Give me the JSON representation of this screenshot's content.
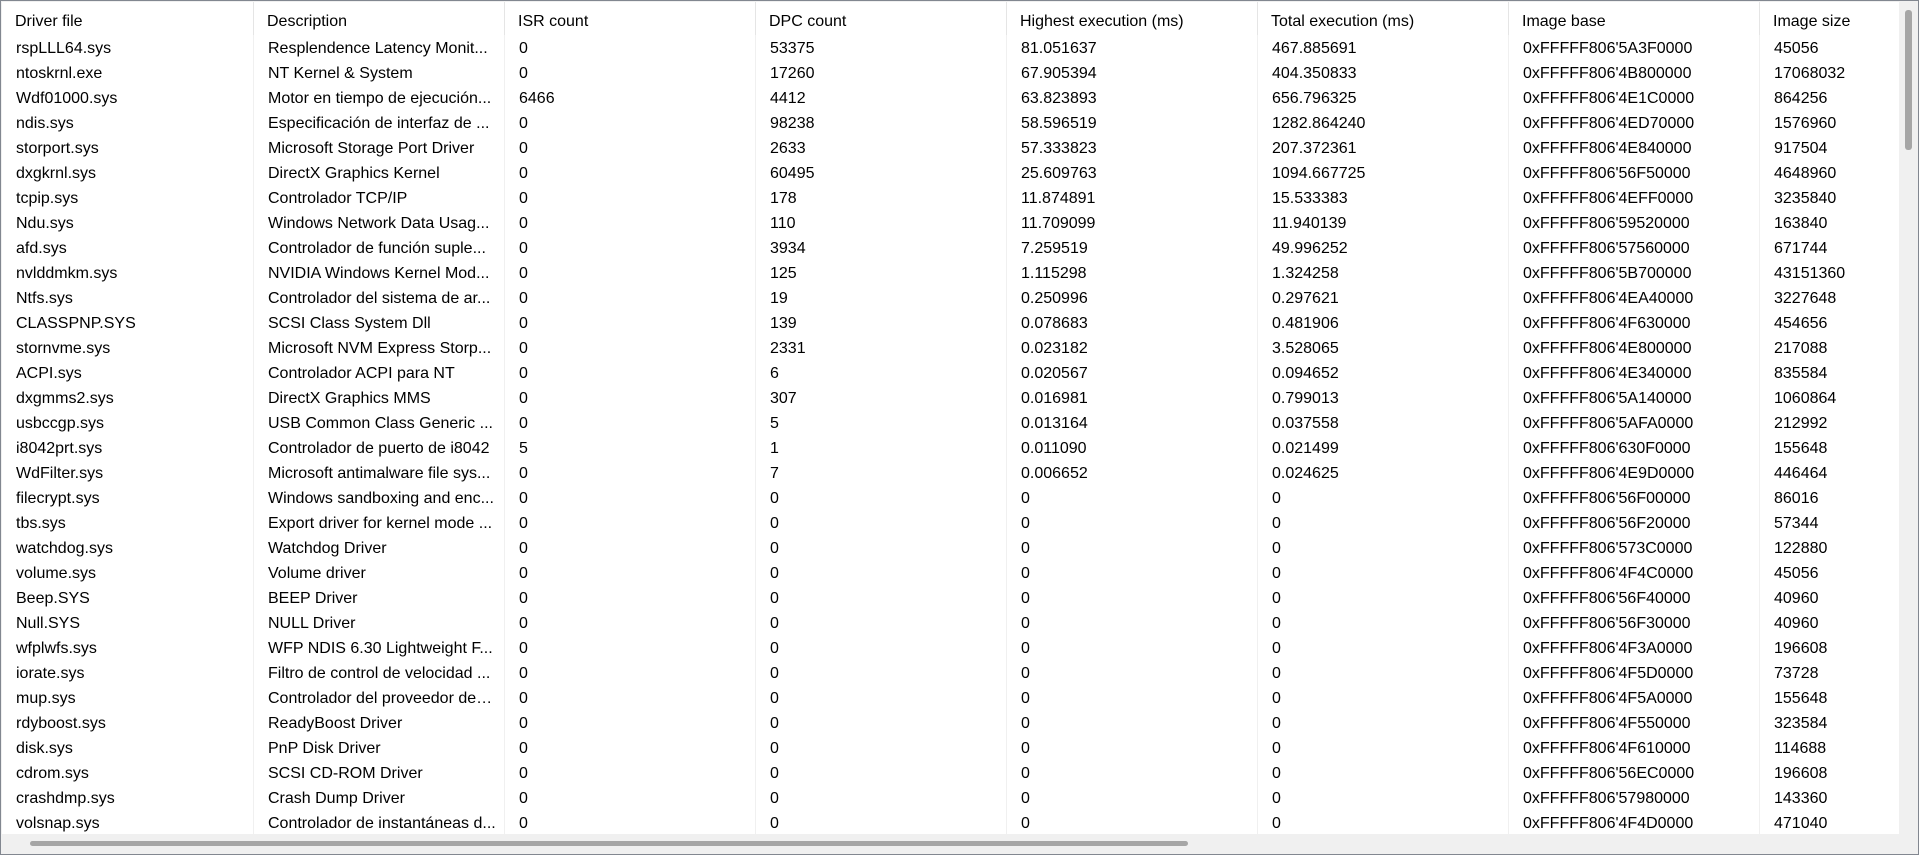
{
  "columns": [
    "Driver file",
    "Description",
    "ISR count",
    "DPC count",
    "Highest execution (ms)",
    "Total execution (ms)",
    "Image base",
    "Image size"
  ],
  "rows": [
    [
      "rspLLL64.sys",
      "Resplendence Latency Monit...",
      "0",
      "53375",
      "81.051637",
      "467.885691",
      "0xFFFFF806'5A3F0000",
      "45056"
    ],
    [
      "ntoskrnl.exe",
      "NT Kernel & System",
      "0",
      "17260",
      "67.905394",
      "404.350833",
      "0xFFFFF806'4B800000",
      "17068032"
    ],
    [
      "Wdf01000.sys",
      "Motor en tiempo de ejecución...",
      "6466",
      "4412",
      "63.823893",
      "656.796325",
      "0xFFFFF806'4E1C0000",
      "864256"
    ],
    [
      "ndis.sys",
      "Especificación de interfaz de ...",
      "0",
      "98238",
      "58.596519",
      "1282.864240",
      "0xFFFFF806'4ED70000",
      "1576960"
    ],
    [
      "storport.sys",
      "Microsoft Storage Port Driver",
      "0",
      "2633",
      "57.333823",
      "207.372361",
      "0xFFFFF806'4E840000",
      "917504"
    ],
    [
      "dxgkrnl.sys",
      "DirectX Graphics Kernel",
      "0",
      "60495",
      "25.609763",
      "1094.667725",
      "0xFFFFF806'56F50000",
      "4648960"
    ],
    [
      "tcpip.sys",
      "Controlador TCP/IP",
      "0",
      "178",
      "11.874891",
      "15.533383",
      "0xFFFFF806'4EFF0000",
      "3235840"
    ],
    [
      "Ndu.sys",
      "Windows Network Data Usag...",
      "0",
      "110",
      "11.709099",
      "11.940139",
      "0xFFFFF806'59520000",
      "163840"
    ],
    [
      "afd.sys",
      "Controlador de función suple...",
      "0",
      "3934",
      "7.259519",
      "49.996252",
      "0xFFFFF806'57560000",
      "671744"
    ],
    [
      "nvlddmkm.sys",
      "NVIDIA Windows Kernel Mod...",
      "0",
      "125",
      "1.115298",
      "1.324258",
      "0xFFFFF806'5B700000",
      "43151360"
    ],
    [
      "Ntfs.sys",
      "Controlador del sistema de ar...",
      "0",
      "19",
      "0.250996",
      "0.297621",
      "0xFFFFF806'4EA40000",
      "3227648"
    ],
    [
      "CLASSPNP.SYS",
      "SCSI Class System Dll",
      "0",
      "139",
      "0.078683",
      "0.481906",
      "0xFFFFF806'4F630000",
      "454656"
    ],
    [
      "stornvme.sys",
      "Microsoft NVM Express Storp...",
      "0",
      "2331",
      "0.023182",
      "3.528065",
      "0xFFFFF806'4E800000",
      "217088"
    ],
    [
      "ACPI.sys",
      "Controlador ACPI para NT",
      "0",
      "6",
      "0.020567",
      "0.094652",
      "0xFFFFF806'4E340000",
      "835584"
    ],
    [
      "dxgmms2.sys",
      "DirectX Graphics MMS",
      "0",
      "307",
      "0.016981",
      "0.799013",
      "0xFFFFF806'5A140000",
      "1060864"
    ],
    [
      "usbccgp.sys",
      "USB Common Class Generic ...",
      "0",
      "5",
      "0.013164",
      "0.037558",
      "0xFFFFF806'5AFA0000",
      "212992"
    ],
    [
      "i8042prt.sys",
      "Controlador de puerto de i8042",
      "5",
      "1",
      "0.011090",
      "0.021499",
      "0xFFFFF806'630F0000",
      "155648"
    ],
    [
      "WdFilter.sys",
      "Microsoft antimalware file sys...",
      "0",
      "7",
      "0.006652",
      "0.024625",
      "0xFFFFF806'4E9D0000",
      "446464"
    ],
    [
      "filecrypt.sys",
      "Windows sandboxing and enc...",
      "0",
      "0",
      "0",
      "0",
      "0xFFFFF806'56F00000",
      "86016"
    ],
    [
      "tbs.sys",
      "Export driver for kernel mode ...",
      "0",
      "0",
      "0",
      "0",
      "0xFFFFF806'56F20000",
      "57344"
    ],
    [
      "watchdog.sys",
      "Watchdog Driver",
      "0",
      "0",
      "0",
      "0",
      "0xFFFFF806'573C0000",
      "122880"
    ],
    [
      "volume.sys",
      "Volume driver",
      "0",
      "0",
      "0",
      "0",
      "0xFFFFF806'4F4C0000",
      "45056"
    ],
    [
      "Beep.SYS",
      "BEEP Driver",
      "0",
      "0",
      "0",
      "0",
      "0xFFFFF806'56F40000",
      "40960"
    ],
    [
      "Null.SYS",
      "NULL Driver",
      "0",
      "0",
      "0",
      "0",
      "0xFFFFF806'56F30000",
      "40960"
    ],
    [
      "wfplwfs.sys",
      "WFP NDIS 6.30 Lightweight F...",
      "0",
      "0",
      "0",
      "0",
      "0xFFFFF806'4F3A0000",
      "196608"
    ],
    [
      "iorate.sys",
      "Filtro de control de velocidad ...",
      "0",
      "0",
      "0",
      "0",
      "0xFFFFF806'4F5D0000",
      "73728"
    ],
    [
      "mup.sys",
      "Controlador del proveedor de v...",
      "0",
      "0",
      "0",
      "0",
      "0xFFFFF806'4F5A0000",
      "155648"
    ],
    [
      "rdyboost.sys",
      "ReadyBoost Driver",
      "0",
      "0",
      "0",
      "0",
      "0xFFFFF806'4F550000",
      "323584"
    ],
    [
      "disk.sys",
      "PnP Disk Driver",
      "0",
      "0",
      "0",
      "0",
      "0xFFFFF806'4F610000",
      "114688"
    ],
    [
      "cdrom.sys",
      "SCSI CD-ROM Driver",
      "0",
      "0",
      "0",
      "0",
      "0xFFFFF806'56EC0000",
      "196608"
    ],
    [
      "crashdmp.sys",
      "Crash Dump Driver",
      "0",
      "0",
      "0",
      "0",
      "0xFFFFF806'57980000",
      "143360"
    ],
    [
      "volsnap.sys",
      "Controlador de instantáneas d...",
      "0",
      "0",
      "0",
      "0",
      "0xFFFFF806'4F4D0000",
      "471040"
    ]
  ]
}
